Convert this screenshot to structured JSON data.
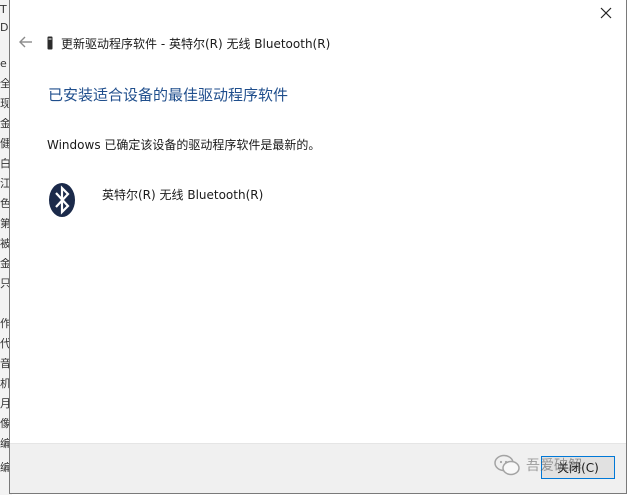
{
  "background_window": {
    "visible_chars": [
      "T",
      "DE",
      "e",
      "全",
      "现",
      "金",
      "健",
      "白",
      "江",
      "色",
      "第",
      "被",
      "金",
      "只",
      "作",
      "代",
      "音",
      "机",
      "月",
      "像",
      "编",
      "编"
    ]
  },
  "dialog": {
    "close_glyph": "✕",
    "back_glyph": "←",
    "title": "更新驱动程序软件 - 英特尔(R) 无线 Bluetooth(R)",
    "heading": "已安装适合设备的最佳驱动程序软件",
    "message": "Windows 已确定该设备的驱动程序软件是最新的。",
    "device_name": "英特尔(R) 无线 Bluetooth(R)",
    "close_button_label": "关闭(C)"
  },
  "watermark": {
    "text": "吾爱破解"
  },
  "colors": {
    "heading": "#1f4e8c",
    "bluetooth_icon": "#1b2a4a",
    "button_border": "#0078d7",
    "footer_bg": "#f0f0f0"
  }
}
